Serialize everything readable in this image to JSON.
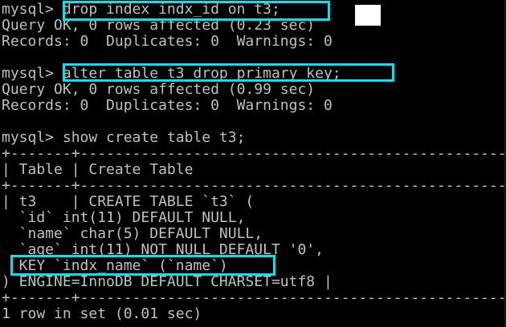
{
  "terminal": {
    "lines": [
      "mysql> drop index indx_id on t3;",
      "Query OK, 0 rows affected (0.23 sec)",
      "Records: 0  Duplicates: 0  Warnings: 0",
      "",
      "mysql> alter table t3 drop primary key;",
      "Query OK, 0 rows affected (0.99 sec)",
      "Records: 0  Duplicates: 0  Warnings: 0",
      "",
      "mysql> show create table t3;",
      "+-------+------------------------------------------------------------------",
      "| Table | Create Table",
      "+-------+------------------------------------------------------------------",
      "| t3    | CREATE TABLE `t3` (",
      "  `id` int(11) DEFAULT NULL,",
      "  `name` char(5) DEFAULT NULL,",
      "  `age` int(11) NOT NULL DEFAULT '0',",
      "  KEY `indx_name` (`name`)",
      ") ENGINE=InnoDB DEFAULT CHARSET=utf8 |",
      "+-------+------------------------------------------------------------------",
      "1 row in set (0.01 sec)"
    ]
  },
  "colors": {
    "background": "#000000",
    "text": "#c0c0c0",
    "highlight_border": "#00e5ee"
  }
}
